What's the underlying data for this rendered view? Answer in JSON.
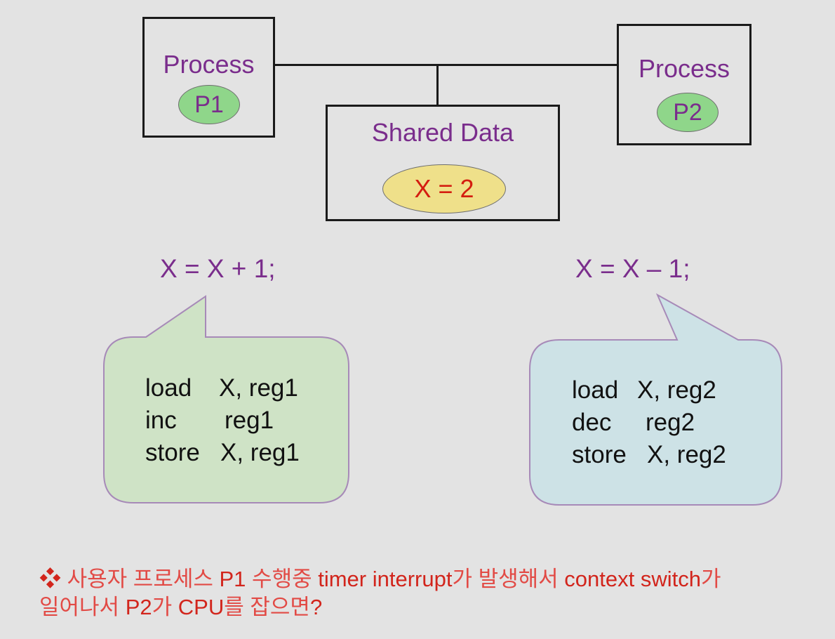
{
  "process1": {
    "title": "Process",
    "id": "P1"
  },
  "process2": {
    "title": "Process",
    "id": "P2"
  },
  "shared": {
    "title": "Shared Data",
    "value": "X = 2"
  },
  "statements": {
    "p1": "X = X + 1;",
    "p2": "X = X – 1;"
  },
  "code_p1": [
    {
      "op": "load",
      "args": "X, reg1"
    },
    {
      "op": "inc",
      "args": "reg1"
    },
    {
      "op": "store",
      "args": "X, reg1"
    }
  ],
  "code_p2": [
    {
      "op": "load",
      "args": "X, reg2"
    },
    {
      "op": "dec",
      "args": "reg2"
    },
    {
      "op": "store",
      "args": "X, reg2"
    }
  ],
  "question": {
    "bullet": "❖",
    "parts": [
      "사용자 프로세스",
      " P1 ",
      "수행중",
      " timer interrupt",
      "가 발생해서",
      " context switch",
      "가",
      "일어나서",
      " P2",
      "가",
      " CPU",
      "를 잡으면",
      "?"
    ]
  },
  "colors": {
    "purple_text": "#7a2d8c",
    "red_text": "#d41d10",
    "green_fill": "#8fd68a",
    "yellow_fill": "#efe08a",
    "bubble_green": "#cfe3c6",
    "bubble_blue": "#cde2e6",
    "bubble_border": "#a78ab8"
  }
}
